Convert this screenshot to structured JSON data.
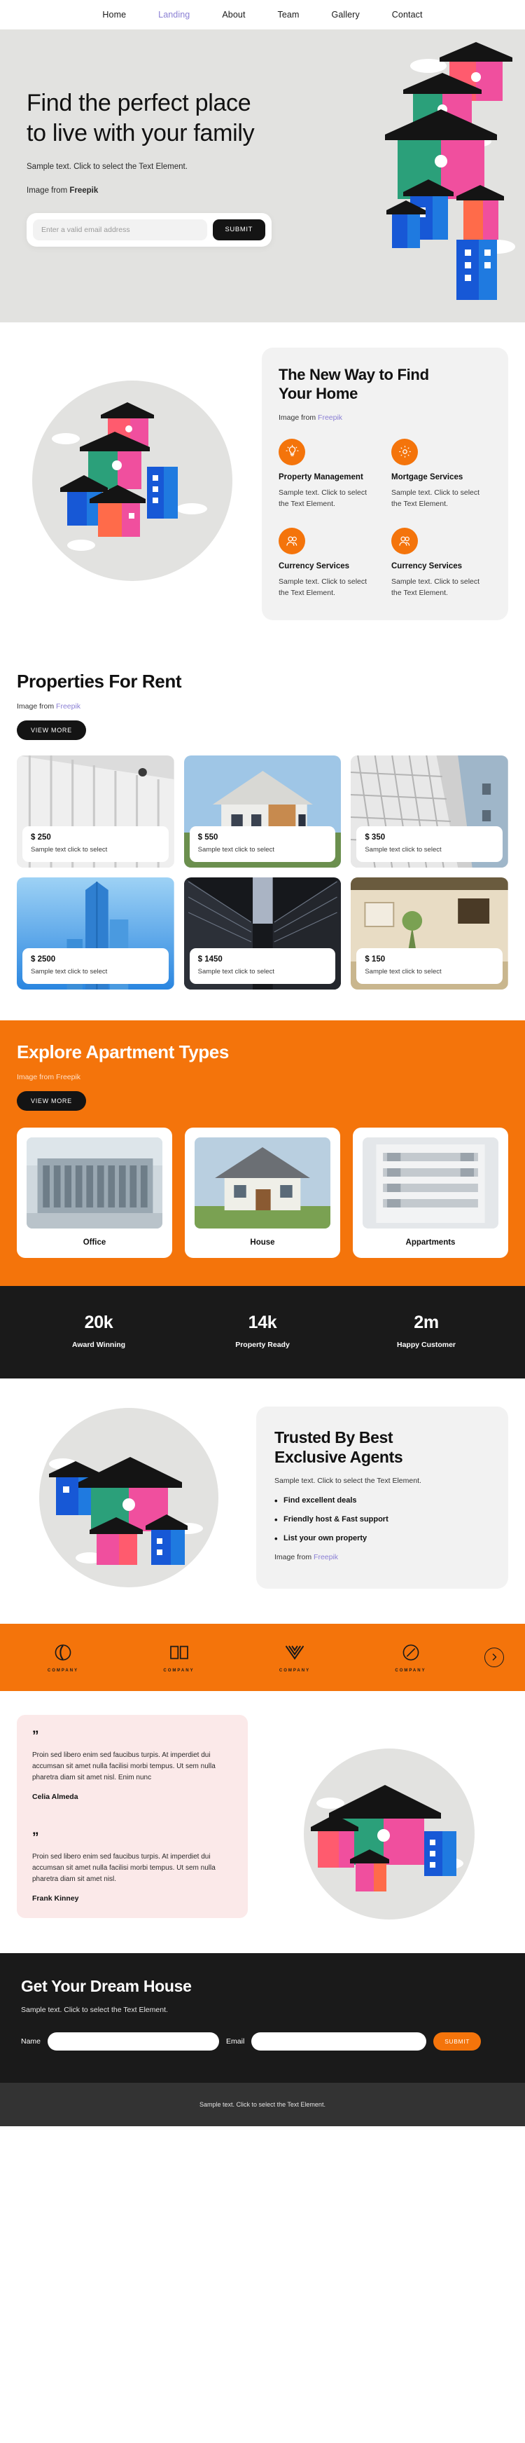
{
  "nav": {
    "items": [
      {
        "label": "Home",
        "active": false
      },
      {
        "label": "Landing",
        "active": true
      },
      {
        "label": "About",
        "active": false
      },
      {
        "label": "Team",
        "active": false
      },
      {
        "label": "Gallery",
        "active": false
      },
      {
        "label": "Contact",
        "active": false
      }
    ]
  },
  "hero": {
    "title_line1": "Find the perfect place",
    "title_line2": "to live with your family",
    "subtitle": "Sample text. Click to select the Text Element.",
    "credit_prefix": "Image from ",
    "credit_link": "Freepik",
    "email_placeholder": "Enter a valid email address",
    "email_value": "",
    "submit_label": "SUBMIT"
  },
  "find_section": {
    "title_line1": "The New Way to Find",
    "title_line2": "Your Home",
    "credit_prefix": "Image from ",
    "credit_link": "Freepik",
    "features": [
      {
        "icon": "lightbulb-icon",
        "title": "Property Management",
        "desc": "Sample text. Click to select the Text Element."
      },
      {
        "icon": "gear-icon",
        "title": "Mortgage Services",
        "desc": "Sample text. Click to select the Text Element."
      },
      {
        "icon": "people-icon",
        "title": "Currency Services",
        "desc": "Sample text. Click to select the Text Element."
      },
      {
        "icon": "people-icon",
        "title": "Currency Services",
        "desc": "Sample text. Click to select the Text Element."
      }
    ]
  },
  "properties": {
    "title": "Properties For Rent",
    "credit_prefix": "Image from ",
    "credit_link": "Freepik",
    "view_more_label": "VIEW MORE",
    "cards": [
      {
        "price": "$ 250",
        "desc": "Sample text click to select",
        "theme": "corridor"
      },
      {
        "price": "$ 550",
        "desc": "Sample text click to select",
        "theme": "house"
      },
      {
        "price": "$ 350",
        "desc": "Sample text click to select",
        "theme": "tower-bw"
      },
      {
        "price": "$ 2500",
        "desc": "Sample text click to select",
        "theme": "sky-tower"
      },
      {
        "price": "$ 1450",
        "desc": "Sample text click to select",
        "theme": "dark-tunnel"
      },
      {
        "price": "$ 150",
        "desc": "Sample text click to select",
        "theme": "villa"
      }
    ]
  },
  "types": {
    "title": "Explore Apartment Types",
    "credit_prefix": "Image from ",
    "credit_link": "Freepik",
    "view_more_label": "VIEW MORE",
    "cards": [
      {
        "label": "Office",
        "theme": "office"
      },
      {
        "label": "House",
        "theme": "house"
      },
      {
        "label": "Appartments",
        "theme": "apartments"
      }
    ]
  },
  "stats": {
    "items": [
      {
        "value": "20k",
        "label": "Award Winning"
      },
      {
        "value": "14k",
        "label": "Property Ready"
      },
      {
        "value": "2m",
        "label": "Happy Customer"
      }
    ]
  },
  "trusted": {
    "title_line1": "Trusted By Best",
    "title_line2": "Exclusive Agents",
    "subtitle": "Sample text. Click to select the Text Element.",
    "bullets": [
      "Find excellent deals",
      "Friendly host & Fast support",
      "List your own property"
    ],
    "credit_prefix": "Image from ",
    "credit_link": "Freepik"
  },
  "logos": {
    "items": [
      {
        "name": "COMPANY",
        "mark": "circle-swirl-icon"
      },
      {
        "name": "COMPANY",
        "mark": "open-book-icon"
      },
      {
        "name": "COMPANY",
        "mark": "chevron-stack-icon"
      },
      {
        "name": "COMPANY",
        "mark": "circle-ring-icon"
      }
    ],
    "next_label": "next-arrow-icon"
  },
  "testimonials": {
    "items": [
      {
        "quote_mark": "”",
        "text": "Proin sed libero enim sed faucibus turpis. At imperdiet dui accumsan sit amet nulla facilisi morbi tempus. Ut sem nulla pharetra diam sit amet nisl. Enim nunc",
        "name": "Celia Almeda"
      },
      {
        "quote_mark": "”",
        "text": "Proin sed libero enim sed faucibus turpis. At imperdiet dui accumsan sit amet nulla facilisi morbi tempus. Ut sem nulla pharetra diam sit amet nisl.",
        "name": "Frank Kinney"
      }
    ]
  },
  "cta": {
    "title": "Get Your Dream House",
    "subtitle": "Sample text. Click to select the Text Element.",
    "name_label": "Name",
    "name_value": "",
    "name_placeholder": "",
    "email_label": "Email",
    "email_value": "",
    "email_placeholder": "",
    "submit_label": "SUBMIT"
  },
  "footer": {
    "text": "Sample text. Click to select the Text Element."
  },
  "colors": {
    "orange": "#f4740b",
    "dark": "#1a1a1a",
    "hero_bg": "#e2e2e0",
    "card_bg": "#f2f2f2",
    "testimonial_bg": "#fbe9e9",
    "link_purple": "#8a7fd4",
    "footer_bg": "#333333"
  }
}
